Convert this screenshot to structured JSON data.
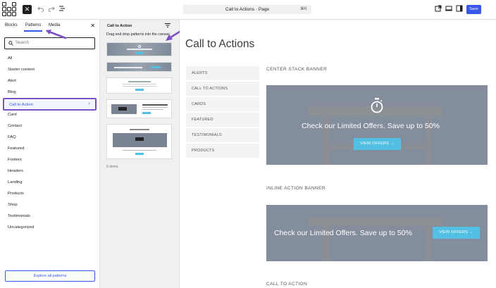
{
  "topbar": {
    "close_glyph": "✕",
    "undo_icon": "undo-icon",
    "redo_icon": "redo-icon",
    "list_view_icon": "list-view-icon",
    "document_title": "Call to Actions · Page",
    "shortcut": "⌘K",
    "save_label": "Save",
    "accent_color": "#3858e9"
  },
  "sidebar": {
    "tabs": [
      "Blocks",
      "Patterns",
      "Media"
    ],
    "active_tab": "Patterns",
    "close_glyph": "✕",
    "search_placeholder": "Search",
    "categories": [
      "All",
      "Starter content",
      "Alert",
      "Blog",
      "Call to Action",
      "Card",
      "Contact",
      "FAQ",
      "Featured",
      "Footers",
      "Headers",
      "Landing",
      "Products",
      "Shop",
      "Testimonials",
      "Uncategorized"
    ],
    "active_category": "Call to Action",
    "active_chevron": "›",
    "explore_label": "Explore all patterns",
    "highlight_color": "#7b4fc6"
  },
  "patterns_panel": {
    "title": "Call to Action",
    "description": "Drag and drop patterns into the canvas.",
    "count_label": "5 items"
  },
  "canvas": {
    "page_title": "Call to Actions",
    "nav_items": [
      "ALERTS",
      "CALL TO ACTIONS",
      "CARDS",
      "FEATURED",
      "TESTIMONIALS",
      "PRODUCTS"
    ],
    "sections": [
      {
        "label": "CENTER STACK BANNER",
        "text": "Check our Limited Offers. Save up to 50%",
        "button": "VIEW OFFERS →"
      },
      {
        "label": "INLINE ACTION BANNER",
        "text": "Check our Limited Offers. Save up to 50%",
        "button": "VIEW OFFERS →"
      },
      {
        "label": "CALL TO ACTION"
      }
    ],
    "button_color": "#52bfe3"
  }
}
